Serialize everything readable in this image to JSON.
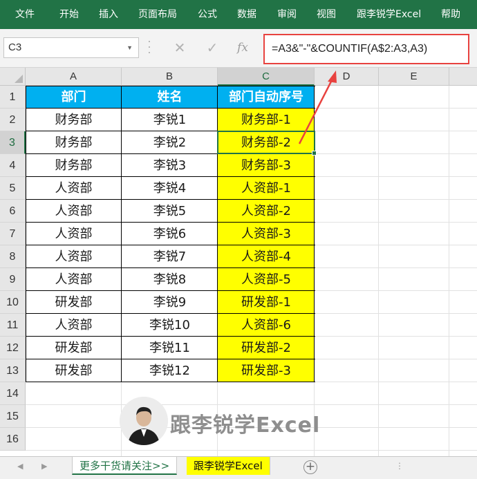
{
  "ribbon": {
    "tabs": [
      "文件",
      "开始",
      "插入",
      "页面布局",
      "公式",
      "数据",
      "审阅",
      "视图",
      "跟李锐学Excel",
      "帮助"
    ]
  },
  "formula_bar": {
    "name_box": "C3",
    "cancel_icon": "✕",
    "enter_icon": "✓",
    "fx_label": "fx",
    "formula": "=A3&\"-\"&COUNTIF(A$2:A3,A3)"
  },
  "columns": [
    "A",
    "B",
    "C",
    "D",
    "E"
  ],
  "rows": [
    "1",
    "2",
    "3",
    "4",
    "5",
    "6",
    "7",
    "8",
    "9",
    "10",
    "11",
    "12",
    "13",
    "14",
    "15",
    "16"
  ],
  "table": {
    "headers": [
      "部门",
      "姓名",
      "部门自动序号"
    ],
    "data": [
      [
        "财务部",
        "李锐1",
        "财务部-1"
      ],
      [
        "财务部",
        "李锐2",
        "财务部-2"
      ],
      [
        "财务部",
        "李锐3",
        "财务部-3"
      ],
      [
        "人资部",
        "李锐4",
        "人资部-1"
      ],
      [
        "人资部",
        "李锐5",
        "人资部-2"
      ],
      [
        "人资部",
        "李锐6",
        "人资部-3"
      ],
      [
        "人资部",
        "李锐7",
        "人资部-4"
      ],
      [
        "人资部",
        "李锐8",
        "人资部-5"
      ],
      [
        "研发部",
        "李锐9",
        "研发部-1"
      ],
      [
        "人资部",
        "李锐10",
        "人资部-6"
      ],
      [
        "研发部",
        "李锐11",
        "研发部-2"
      ],
      [
        "研发部",
        "李锐12",
        "研发部-3"
      ]
    ]
  },
  "watermark": {
    "text": "跟李锐学Excel"
  },
  "sheet_tabs": {
    "items": [
      "更多干货请关注>>",
      "跟李锐学Excel"
    ],
    "add_icon": "+",
    "more_icon": "⋮"
  },
  "colors": {
    "ribbon": "#217346",
    "header_fill": "#00b0f0",
    "highlight_fill": "#ffff00",
    "annotation": "#e8423f"
  }
}
